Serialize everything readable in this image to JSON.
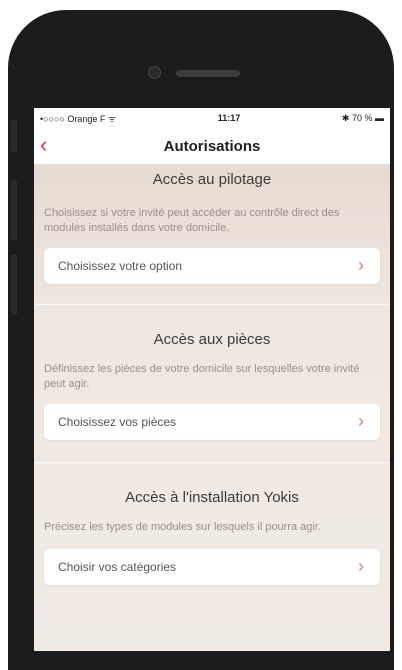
{
  "status": {
    "carrier": "•○○○○ Orange F ᯤ",
    "time": "11:17",
    "battery": "✱ 70 % ▬"
  },
  "nav": {
    "back_icon": "chevron-left",
    "title": "Autorisations"
  },
  "sections": [
    {
      "heading": "Accès au pilotage",
      "description": "Choisissez si votre invité peut accéder au contrôle direct des modules installés dans votre domicile.",
      "option": "Choisissez votre option"
    },
    {
      "heading": "Accès aux pièces",
      "description": "Définissez les pièces de votre domicile sur lesquelles votre invité peut agir.",
      "option": "Choisissez vos pièces"
    },
    {
      "heading": "Accès à l'installation Yokis",
      "description": "Précisez les types de modules sur lesquels il pourra agir.",
      "option": "Choisir vos catégories"
    }
  ],
  "colors": {
    "accent": "#d63a3a",
    "chevron": "#e07a7a"
  }
}
